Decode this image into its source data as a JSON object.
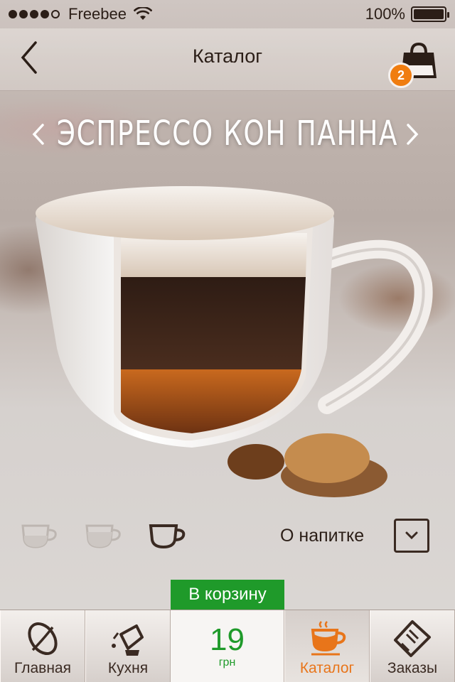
{
  "status_bar": {
    "carrier": "Freebee",
    "battery": "100%"
  },
  "nav": {
    "title": "Каталог",
    "cart_count": "2"
  },
  "product": {
    "name": "ЭСПРЕССО КОН ПАННА"
  },
  "size_selector": {
    "options": [
      "small-cup-icon",
      "medium-cup-icon",
      "large-cup-icon"
    ],
    "selected": 2
  },
  "about": {
    "label": "О напитке"
  },
  "add_to_cart": {
    "label": "В корзину"
  },
  "price": {
    "value": "19",
    "unit": "грн"
  },
  "tabs": [
    {
      "label": "Главная",
      "icon": "coffee-bean-icon"
    },
    {
      "label": "Кухня",
      "icon": "kettle-icon"
    },
    {
      "label": "Каталог",
      "icon": "coffee-cup-icon"
    },
    {
      "label": "Заказы",
      "icon": "receipt-icon"
    }
  ],
  "colors": {
    "accent_green": "#1f9a2a",
    "accent_orange": "#f07d10",
    "text_dark": "#2b1e17"
  }
}
